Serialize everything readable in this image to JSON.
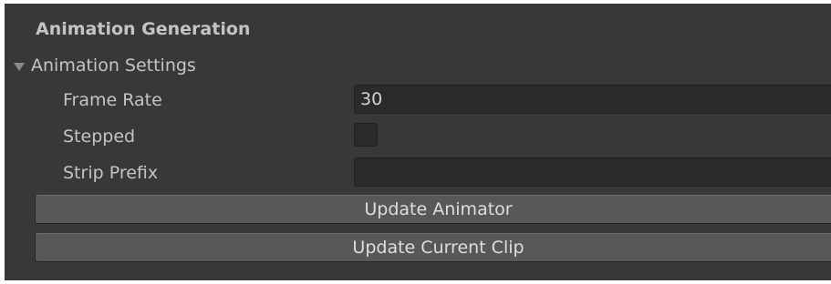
{
  "section": {
    "title": "Animation Generation"
  },
  "foldout": {
    "label": "Animation Settings",
    "expanded": true,
    "arrow_icon": "triangle-down-icon"
  },
  "properties": {
    "frame_rate": {
      "label": "Frame Rate",
      "value": "30"
    },
    "stepped": {
      "label": "Stepped",
      "checked": false
    },
    "strip_prefix": {
      "label": "Strip Prefix",
      "value": ""
    }
  },
  "buttons": {
    "update_animator": "Update Animator",
    "update_current_clip": "Update Current Clip"
  },
  "colors": {
    "panel_background": "#383838",
    "field_background": "#2a2a2a",
    "button_background": "#585858",
    "label_text": "#c4c4c4"
  }
}
